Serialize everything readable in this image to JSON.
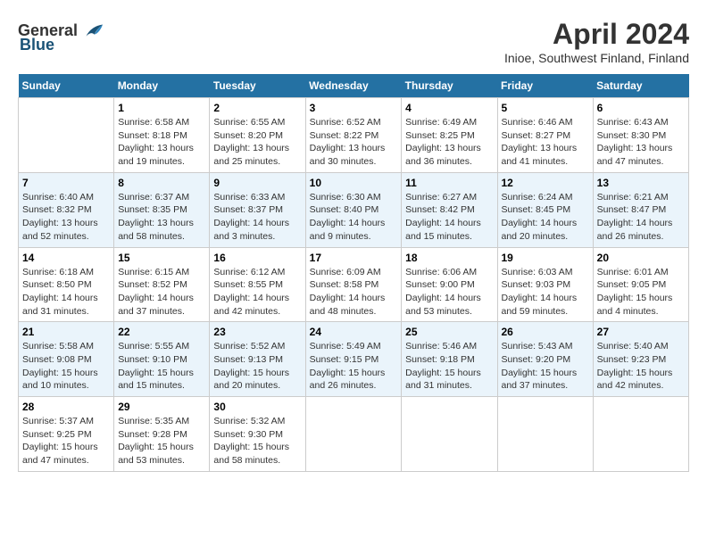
{
  "header": {
    "logo_general": "General",
    "logo_blue": "Blue",
    "title": "April 2024",
    "subtitle": "Inioe, Southwest Finland, Finland"
  },
  "weekdays": [
    "Sunday",
    "Monday",
    "Tuesday",
    "Wednesday",
    "Thursday",
    "Friday",
    "Saturday"
  ],
  "weeks": [
    [
      {
        "day": "",
        "info": ""
      },
      {
        "day": "1",
        "info": "Sunrise: 6:58 AM\nSunset: 8:18 PM\nDaylight: 13 hours\nand 19 minutes."
      },
      {
        "day": "2",
        "info": "Sunrise: 6:55 AM\nSunset: 8:20 PM\nDaylight: 13 hours\nand 25 minutes."
      },
      {
        "day": "3",
        "info": "Sunrise: 6:52 AM\nSunset: 8:22 PM\nDaylight: 13 hours\nand 30 minutes."
      },
      {
        "day": "4",
        "info": "Sunrise: 6:49 AM\nSunset: 8:25 PM\nDaylight: 13 hours\nand 36 minutes."
      },
      {
        "day": "5",
        "info": "Sunrise: 6:46 AM\nSunset: 8:27 PM\nDaylight: 13 hours\nand 41 minutes."
      },
      {
        "day": "6",
        "info": "Sunrise: 6:43 AM\nSunset: 8:30 PM\nDaylight: 13 hours\nand 47 minutes."
      }
    ],
    [
      {
        "day": "7",
        "info": "Sunrise: 6:40 AM\nSunset: 8:32 PM\nDaylight: 13 hours\nand 52 minutes."
      },
      {
        "day": "8",
        "info": "Sunrise: 6:37 AM\nSunset: 8:35 PM\nDaylight: 13 hours\nand 58 minutes."
      },
      {
        "day": "9",
        "info": "Sunrise: 6:33 AM\nSunset: 8:37 PM\nDaylight: 14 hours\nand 3 minutes."
      },
      {
        "day": "10",
        "info": "Sunrise: 6:30 AM\nSunset: 8:40 PM\nDaylight: 14 hours\nand 9 minutes."
      },
      {
        "day": "11",
        "info": "Sunrise: 6:27 AM\nSunset: 8:42 PM\nDaylight: 14 hours\nand 15 minutes."
      },
      {
        "day": "12",
        "info": "Sunrise: 6:24 AM\nSunset: 8:45 PM\nDaylight: 14 hours\nand 20 minutes."
      },
      {
        "day": "13",
        "info": "Sunrise: 6:21 AM\nSunset: 8:47 PM\nDaylight: 14 hours\nand 26 minutes."
      }
    ],
    [
      {
        "day": "14",
        "info": "Sunrise: 6:18 AM\nSunset: 8:50 PM\nDaylight: 14 hours\nand 31 minutes."
      },
      {
        "day": "15",
        "info": "Sunrise: 6:15 AM\nSunset: 8:52 PM\nDaylight: 14 hours\nand 37 minutes."
      },
      {
        "day": "16",
        "info": "Sunrise: 6:12 AM\nSunset: 8:55 PM\nDaylight: 14 hours\nand 42 minutes."
      },
      {
        "day": "17",
        "info": "Sunrise: 6:09 AM\nSunset: 8:58 PM\nDaylight: 14 hours\nand 48 minutes."
      },
      {
        "day": "18",
        "info": "Sunrise: 6:06 AM\nSunset: 9:00 PM\nDaylight: 14 hours\nand 53 minutes."
      },
      {
        "day": "19",
        "info": "Sunrise: 6:03 AM\nSunset: 9:03 PM\nDaylight: 14 hours\nand 59 minutes."
      },
      {
        "day": "20",
        "info": "Sunrise: 6:01 AM\nSunset: 9:05 PM\nDaylight: 15 hours\nand 4 minutes."
      }
    ],
    [
      {
        "day": "21",
        "info": "Sunrise: 5:58 AM\nSunset: 9:08 PM\nDaylight: 15 hours\nand 10 minutes."
      },
      {
        "day": "22",
        "info": "Sunrise: 5:55 AM\nSunset: 9:10 PM\nDaylight: 15 hours\nand 15 minutes."
      },
      {
        "day": "23",
        "info": "Sunrise: 5:52 AM\nSunset: 9:13 PM\nDaylight: 15 hours\nand 20 minutes."
      },
      {
        "day": "24",
        "info": "Sunrise: 5:49 AM\nSunset: 9:15 PM\nDaylight: 15 hours\nand 26 minutes."
      },
      {
        "day": "25",
        "info": "Sunrise: 5:46 AM\nSunset: 9:18 PM\nDaylight: 15 hours\nand 31 minutes."
      },
      {
        "day": "26",
        "info": "Sunrise: 5:43 AM\nSunset: 9:20 PM\nDaylight: 15 hours\nand 37 minutes."
      },
      {
        "day": "27",
        "info": "Sunrise: 5:40 AM\nSunset: 9:23 PM\nDaylight: 15 hours\nand 42 minutes."
      }
    ],
    [
      {
        "day": "28",
        "info": "Sunrise: 5:37 AM\nSunset: 9:25 PM\nDaylight: 15 hours\nand 47 minutes."
      },
      {
        "day": "29",
        "info": "Sunrise: 5:35 AM\nSunset: 9:28 PM\nDaylight: 15 hours\nand 53 minutes."
      },
      {
        "day": "30",
        "info": "Sunrise: 5:32 AM\nSunset: 9:30 PM\nDaylight: 15 hours\nand 58 minutes."
      },
      {
        "day": "",
        "info": ""
      },
      {
        "day": "",
        "info": ""
      },
      {
        "day": "",
        "info": ""
      },
      {
        "day": "",
        "info": ""
      }
    ]
  ]
}
